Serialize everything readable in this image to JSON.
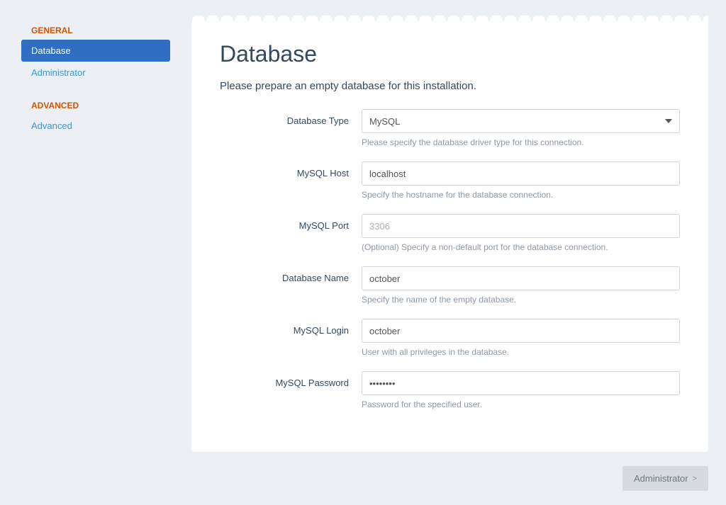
{
  "sidebar": {
    "sections": [
      {
        "heading": "GENERAL",
        "items": [
          {
            "label": "Database",
            "active": true
          },
          {
            "label": "Administrator",
            "active": false
          }
        ]
      },
      {
        "heading": "ADVANCED",
        "items": [
          {
            "label": "Advanced",
            "active": false
          }
        ]
      }
    ]
  },
  "page": {
    "title": "Database",
    "subtitle": "Please prepare an empty database for this installation."
  },
  "form": {
    "db_type": {
      "label": "Database Type",
      "value": "MySQL",
      "help": "Please specify the database driver type for this connection."
    },
    "host": {
      "label": "MySQL Host",
      "value": "localhost",
      "help": "Specify the hostname for the database connection."
    },
    "port": {
      "label": "MySQL Port",
      "placeholder": "3306",
      "value": "",
      "help": "(Optional) Specify a non-default port for the database connection."
    },
    "name": {
      "label": "Database Name",
      "value": "october",
      "help": "Specify the name of the empty database."
    },
    "login": {
      "label": "MySQL Login",
      "value": "october",
      "help": "User with all privileges in the database."
    },
    "password": {
      "label": "MySQL Password",
      "value": "••••••••",
      "help": "Password for the specified user."
    }
  },
  "footer": {
    "next_label": "Administrator"
  }
}
